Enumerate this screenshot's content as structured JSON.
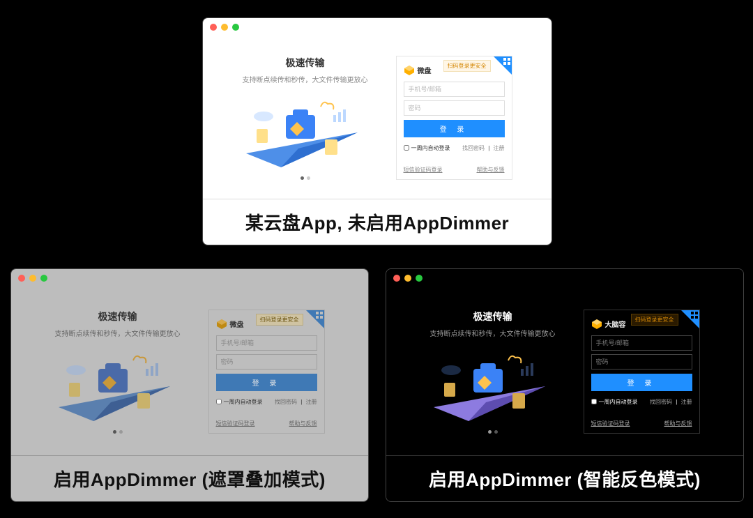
{
  "promo": {
    "title": "极速传输",
    "subtitle": "支持断点续传和秒传，大文件传输更放心"
  },
  "login": {
    "qr_tip": "扫码登录更安全",
    "brand": "微盘",
    "brand_dark": "大脑容",
    "ph_account": "手机号/邮箱",
    "ph_password": "密码",
    "btn": "登 录",
    "auto": "一周内自动登录",
    "forgot": "找回密码",
    "register": "注册",
    "sep": "|",
    "sms": "短信验证码登录",
    "help": "帮助与反馈"
  },
  "captions": {
    "top": "某云盘App, 未启用AppDimmer",
    "left": "启用AppDimmer (遮罩叠加模式)",
    "right": "启用AppDimmer (智能反色模式)"
  },
  "colors": {
    "accent": "#1f8fff",
    "illus_blue": "#4e8fe8",
    "illus_light": "#bcd8ff",
    "illus_yellow": "#ffc34d",
    "dark_plane": "#7b6bd8"
  }
}
